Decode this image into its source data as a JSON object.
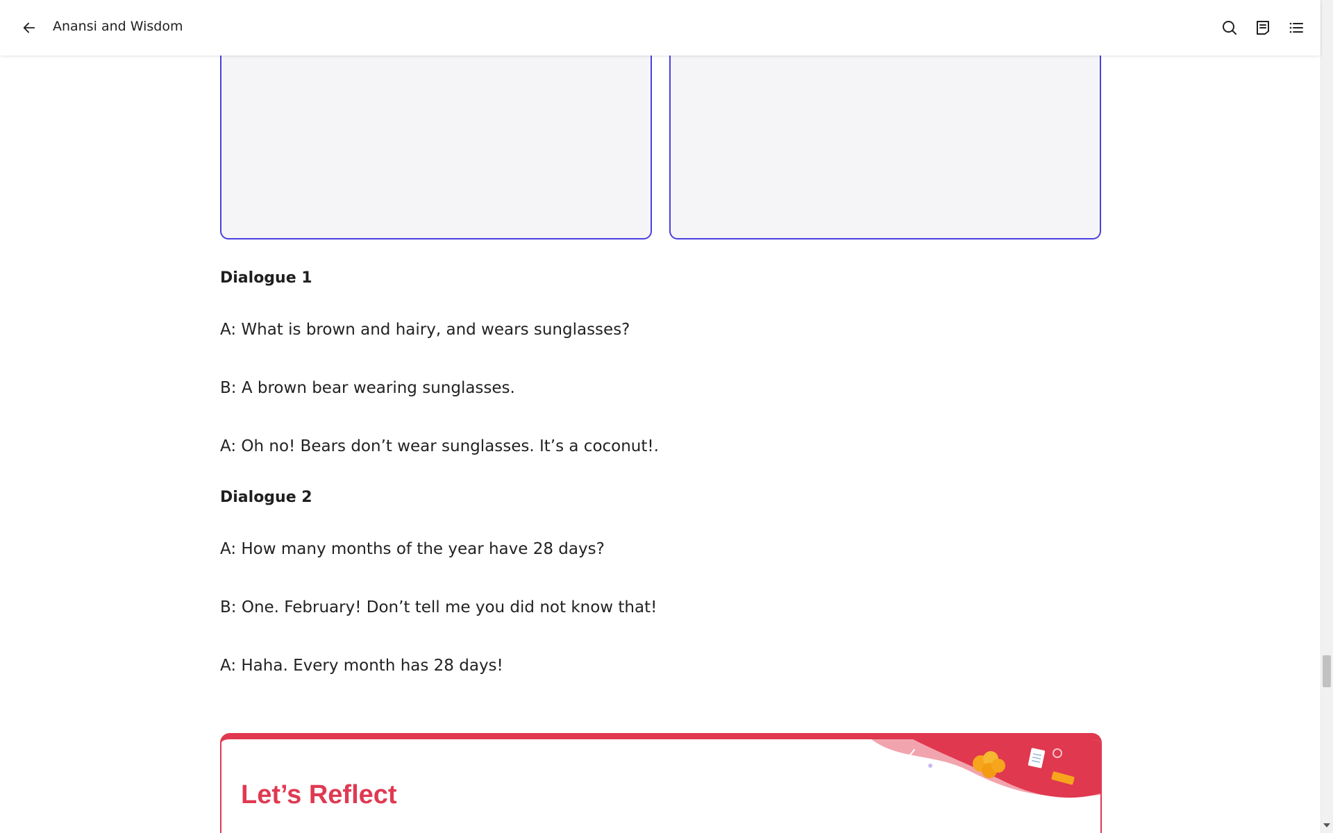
{
  "header": {
    "title": "Anansi and Wisdom"
  },
  "dialogues": [
    {
      "heading": "Dialogue 1",
      "lines": [
        "A: What is brown and hairy, and wears sunglasses?",
        "B: A brown bear wearing sunglasses.",
        "A: Oh no! Bears don’t wear sunglasses. It’s a coconut!."
      ]
    },
    {
      "heading": "Dialogue 2",
      "lines": [
        "A: How many months of the year have 28 days?",
        "B: One. February! Don’t tell me you did not know that!",
        "A: Haha. Every month has 28 days!"
      ]
    }
  ],
  "reflect": {
    "title": "Let’s Reflect"
  },
  "colors": {
    "box_border": "#4a3ee0",
    "reflect_accent": "#df3a52"
  },
  "icons": {
    "back": "arrow-left-icon",
    "search": "search-icon",
    "notes": "notes-icon",
    "toc": "list-icon"
  }
}
